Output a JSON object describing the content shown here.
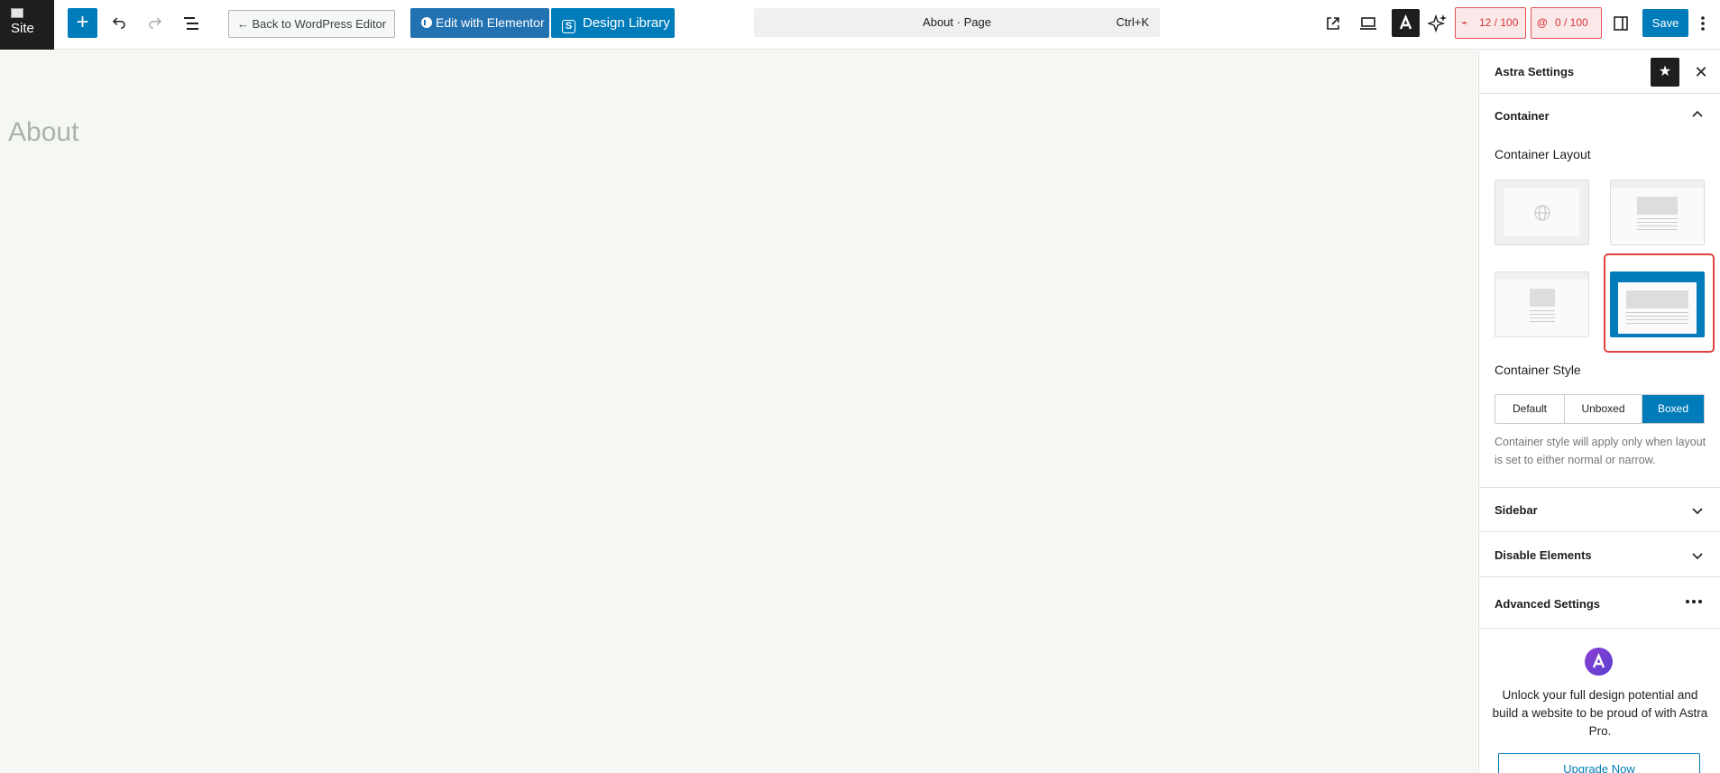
{
  "toolbar": {
    "site_label": "Site",
    "back_label": "← Back to WordPress Editor",
    "elementor_label": "Edit with Elementor",
    "design_library_label": "Design Library",
    "command_title": "About · Page",
    "command_shortcut": "Ctrl+K",
    "score_1": "12 / 100",
    "score_2": "0 / 100",
    "save_label": "Save"
  },
  "canvas": {
    "page_title": "About"
  },
  "sidebar": {
    "title": "Astra Settings",
    "container": {
      "title": "Container",
      "layout_label": "Container Layout",
      "style_label": "Container Style",
      "style_options": [
        "Default",
        "Unboxed",
        "Boxed"
      ],
      "style_selected": "Boxed",
      "help_text": "Container style will apply only when layout is set to either normal or narrow."
    },
    "sections": {
      "sidebar": "Sidebar",
      "disable_elements": "Disable Elements",
      "advanced": "Advanced Settings"
    },
    "promo": {
      "text": "Unlock your full design potential and build a website to be proud of with Astra Pro.",
      "button": "Upgrade Now"
    }
  },
  "colors": {
    "primary": "#007cba",
    "canvas_bg": "#f5f7f3",
    "highlight": "#e3413f",
    "score_red": "#d63638"
  }
}
